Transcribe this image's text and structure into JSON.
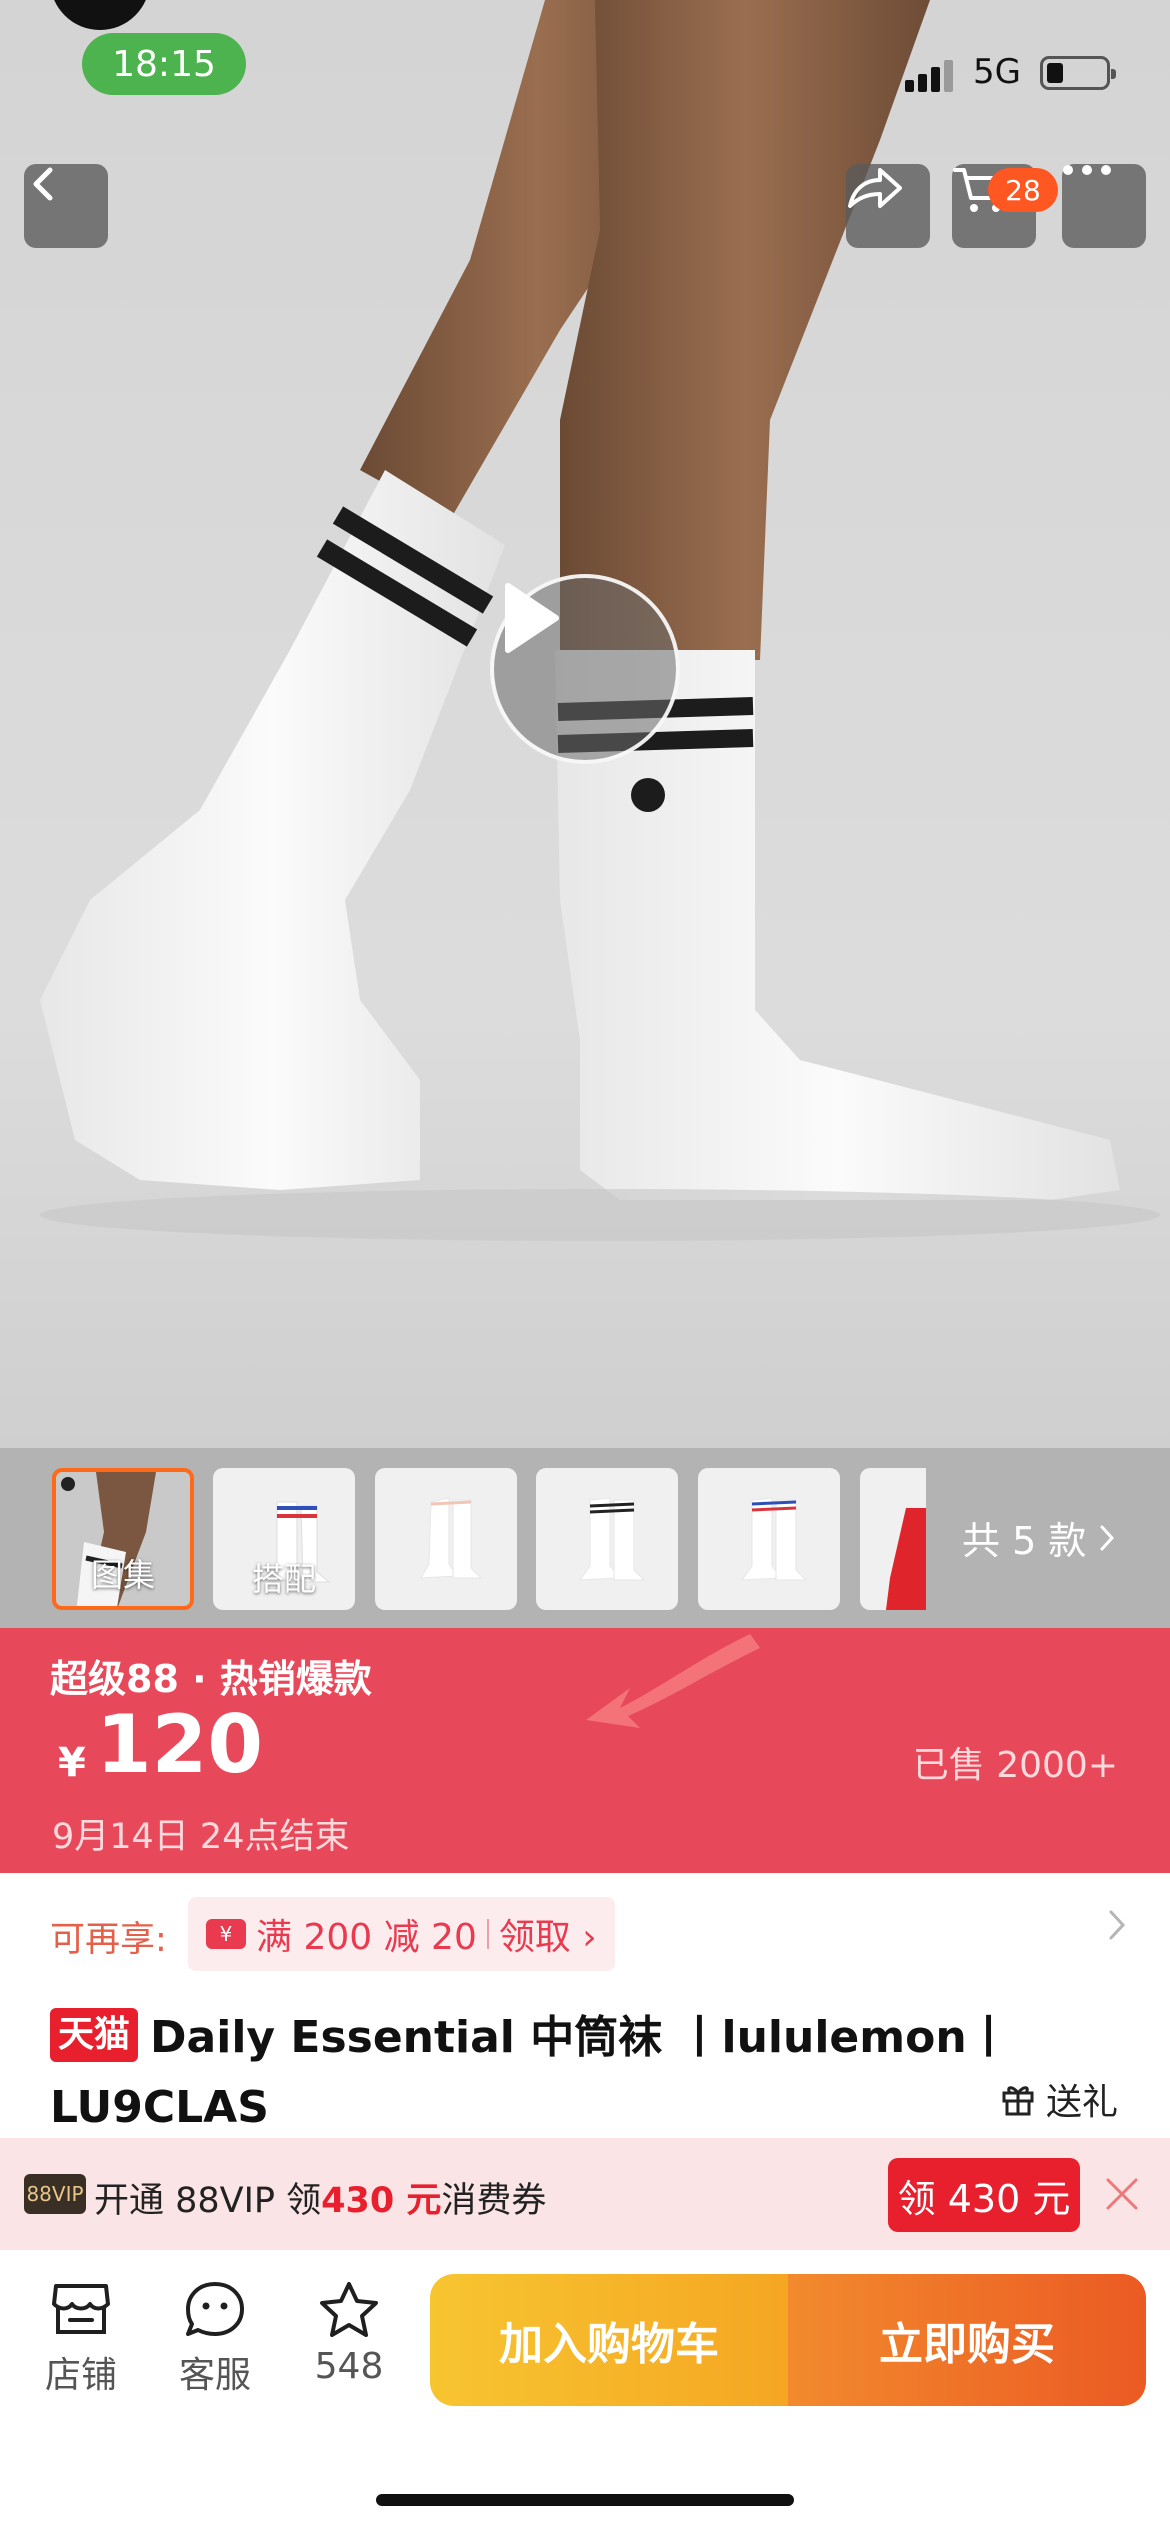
{
  "status_bar": {
    "time": "18:15",
    "network": "5G"
  },
  "header": {
    "cart_count": "28"
  },
  "gallery": {
    "thumbnails": [
      {
        "label": "图集"
      },
      {
        "label": "搭配"
      },
      {
        "label": ""
      },
      {
        "label": ""
      },
      {
        "label": ""
      },
      {
        "label": ""
      }
    ],
    "styles_count": "共 5 款"
  },
  "promo": {
    "title": "超级88 · 热销爆款",
    "currency": "¥",
    "price": "120",
    "sold": "已售 2000+",
    "ends": "9月14日 24点结束"
  },
  "coupon_row": {
    "label": "可再享:",
    "icon_text": "¥",
    "coupon_text": "满 200 减 20",
    "claim_text": "领取 ›"
  },
  "product": {
    "badge": "天猫",
    "title": "Daily Essential 中筒袜 丨lululemon丨LU9CLAS",
    "gift_label": "送礼"
  },
  "vip": {
    "logo": "88VIP",
    "text_before": "开通 88VIP 领",
    "amount": "430 元",
    "text_after": "消费券",
    "claim_button": "领 430 元"
  },
  "bottom_bar": {
    "store": "店铺",
    "service": "客服",
    "favorites": "548",
    "add_to_cart": "加入购物车",
    "buy_now": "立即购买"
  },
  "colors": {
    "promo_red": "#e8495a",
    "tmall_red": "#e8202e",
    "cart_yellow": "#f7c530",
    "buy_orange": "#eb5a23",
    "active_thumb_border": "#ff6a1a"
  }
}
